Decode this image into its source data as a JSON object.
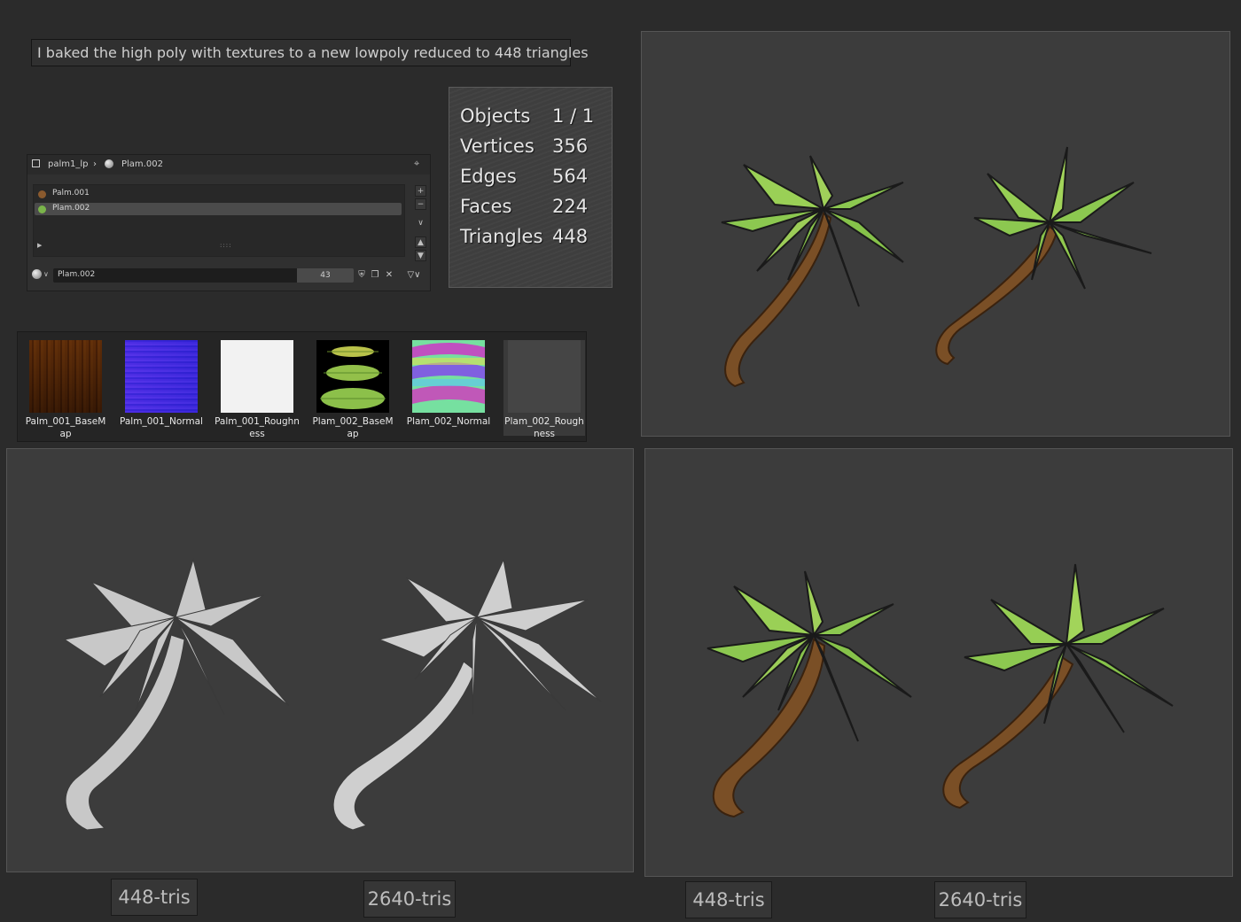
{
  "caption": "I baked the high poly with textures to a new lowpoly reduced to 448 triangles",
  "stats": [
    {
      "label": "Objects",
      "value": "1 / 1"
    },
    {
      "label": "Vertices",
      "value": "356"
    },
    {
      "label": "Edges",
      "value": "564"
    },
    {
      "label": "Faces",
      "value": "224"
    },
    {
      "label": "Triangles",
      "value": "448"
    }
  ],
  "material_panel": {
    "object_name": "palm1_lp",
    "material_name": "Plam.002",
    "slots": [
      {
        "label": "Palm.001",
        "color": "#8a5a2e"
      },
      {
        "label": "Plam.002",
        "color": "#7ab44a"
      }
    ],
    "active_material": "Plam.002",
    "user_count": "43"
  },
  "textures": [
    {
      "label": "Palm_001_BaseMap",
      "icon": "wood-texture"
    },
    {
      "label": "Palm_001_Normal",
      "icon": "normal-map"
    },
    {
      "label": "Palm_001_Roughness",
      "icon": "roughness-map"
    },
    {
      "label": "Plam_002_BaseMap",
      "icon": "leaf-texture"
    },
    {
      "label": "Plam_002_Normal",
      "icon": "normal-map"
    },
    {
      "label": "Plam_002_Roughness",
      "icon": "roughness-map"
    }
  ],
  "labels": {
    "wire_low": "448-tris",
    "wire_high": "2640-tris",
    "tex_low": "448-tris",
    "tex_high": "2640-tris"
  },
  "colors": {
    "leaf": "#7fc04a",
    "leaf_dark": "#2f5e1a",
    "trunk": "#8a5a2e",
    "viewport_bg": "#3c3c3c"
  }
}
